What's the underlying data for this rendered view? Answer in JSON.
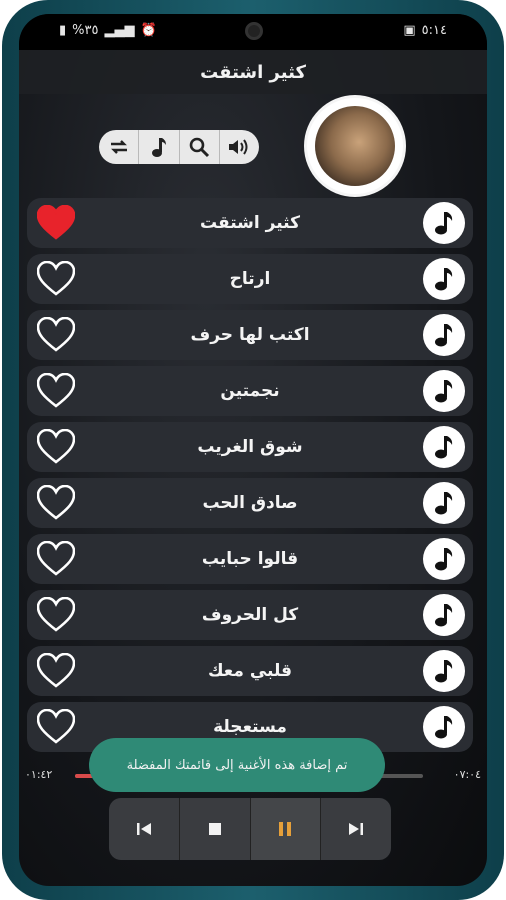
{
  "status": {
    "battery_text": "%٣٥",
    "clock": "٥:١٤"
  },
  "header": {
    "title": "كثير اشتقت"
  },
  "songs": [
    {
      "title": "كثير اشتقت",
      "favorite": true
    },
    {
      "title": "ارتاح",
      "favorite": false
    },
    {
      "title": "اكتب لها حرف",
      "favorite": false
    },
    {
      "title": "نجمتين",
      "favorite": false
    },
    {
      "title": "شوق الغريب",
      "favorite": false
    },
    {
      "title": "صادق الحب",
      "favorite": false
    },
    {
      "title": "قالوا حبايب",
      "favorite": false
    },
    {
      "title": "كل الحروف",
      "favorite": false
    },
    {
      "title": "قلبي معك",
      "favorite": false
    },
    {
      "title": "مستعجلة",
      "favorite": false
    }
  ],
  "player": {
    "elapsed": "٠١:٤٢",
    "total": "٠٧:٠٤",
    "progress_fraction": 0.24
  },
  "toast": {
    "message": "تم إضافة هذه الأغنية إلى قائمتك المفضلة"
  },
  "colors": {
    "heart_active": "#e8232b",
    "toast_bg": "#2f8a76",
    "progress": "#d84a4a"
  },
  "icons": {
    "controls": [
      "repeat-icon",
      "music-note-icon",
      "search-icon",
      "volume-icon"
    ],
    "playback": [
      "skip-previous-icon",
      "stop-icon",
      "pause-icon",
      "skip-next-icon"
    ]
  }
}
